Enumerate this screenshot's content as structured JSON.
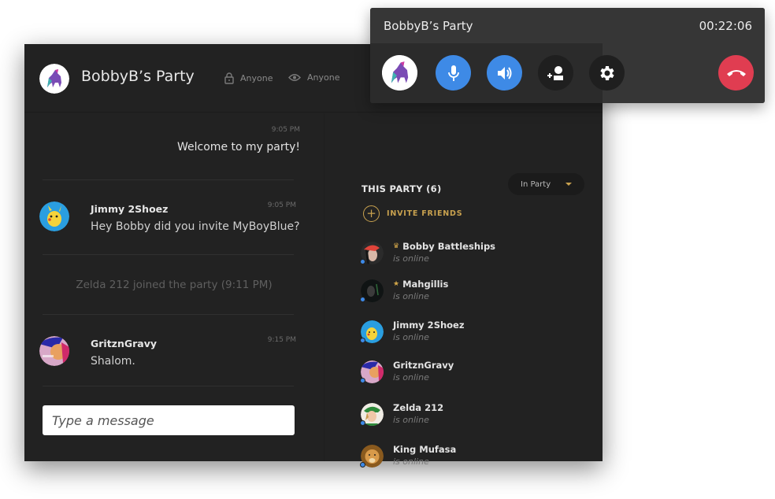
{
  "party": {
    "name": "BobbyB’s Party",
    "privacy": {
      "join": "Anyone",
      "view": "Anyone"
    }
  },
  "call": {
    "title": "BobbyB’s Party",
    "timer": "00:22:06",
    "controls": [
      "avatar",
      "microphone-icon",
      "speaker-icon",
      "add-user-icon",
      "gear-icon",
      "hang-up-icon"
    ]
  },
  "chat": {
    "messages": [
      {
        "type": "own",
        "time": "9:05 PM",
        "text": "Welcome to my party!"
      },
      {
        "type": "message",
        "author": "Jimmy 2Shoez",
        "time": "9:05 PM",
        "text": "Hey Bobby did you invite MyBoyBlue?"
      },
      {
        "type": "system",
        "text": "Zelda 212 joined the party  (9:11 PM)"
      },
      {
        "type": "message",
        "author": "GritznGravy",
        "time": "9:15 PM",
        "text": "Shalom."
      }
    ],
    "input_placeholder": "Type a message"
  },
  "sidebar": {
    "title": "THIS PARTY (6)",
    "filter": "In Party",
    "invite_label": "INVITE FRIENDS",
    "members": [
      {
        "name": "Bobby Battleships",
        "status": "is online",
        "badge": "crown"
      },
      {
        "name": "Mahgillis",
        "status": "is online",
        "badge": "star"
      },
      {
        "name": "Jimmy 2Shoez",
        "status": "is online",
        "badge": ""
      },
      {
        "name": "GritznGravy",
        "status": "is online",
        "badge": ""
      },
      {
        "name": "Zelda 212",
        "status": "is online",
        "badge": ""
      },
      {
        "name": "King Mufasa",
        "status": "is online",
        "badge": ""
      }
    ]
  },
  "colors": {
    "accent_gold": "#c9a24f",
    "primary_blue": "#3e8ae6",
    "hangup_red": "#e03d51",
    "online_dot": "#3d8ae8"
  }
}
